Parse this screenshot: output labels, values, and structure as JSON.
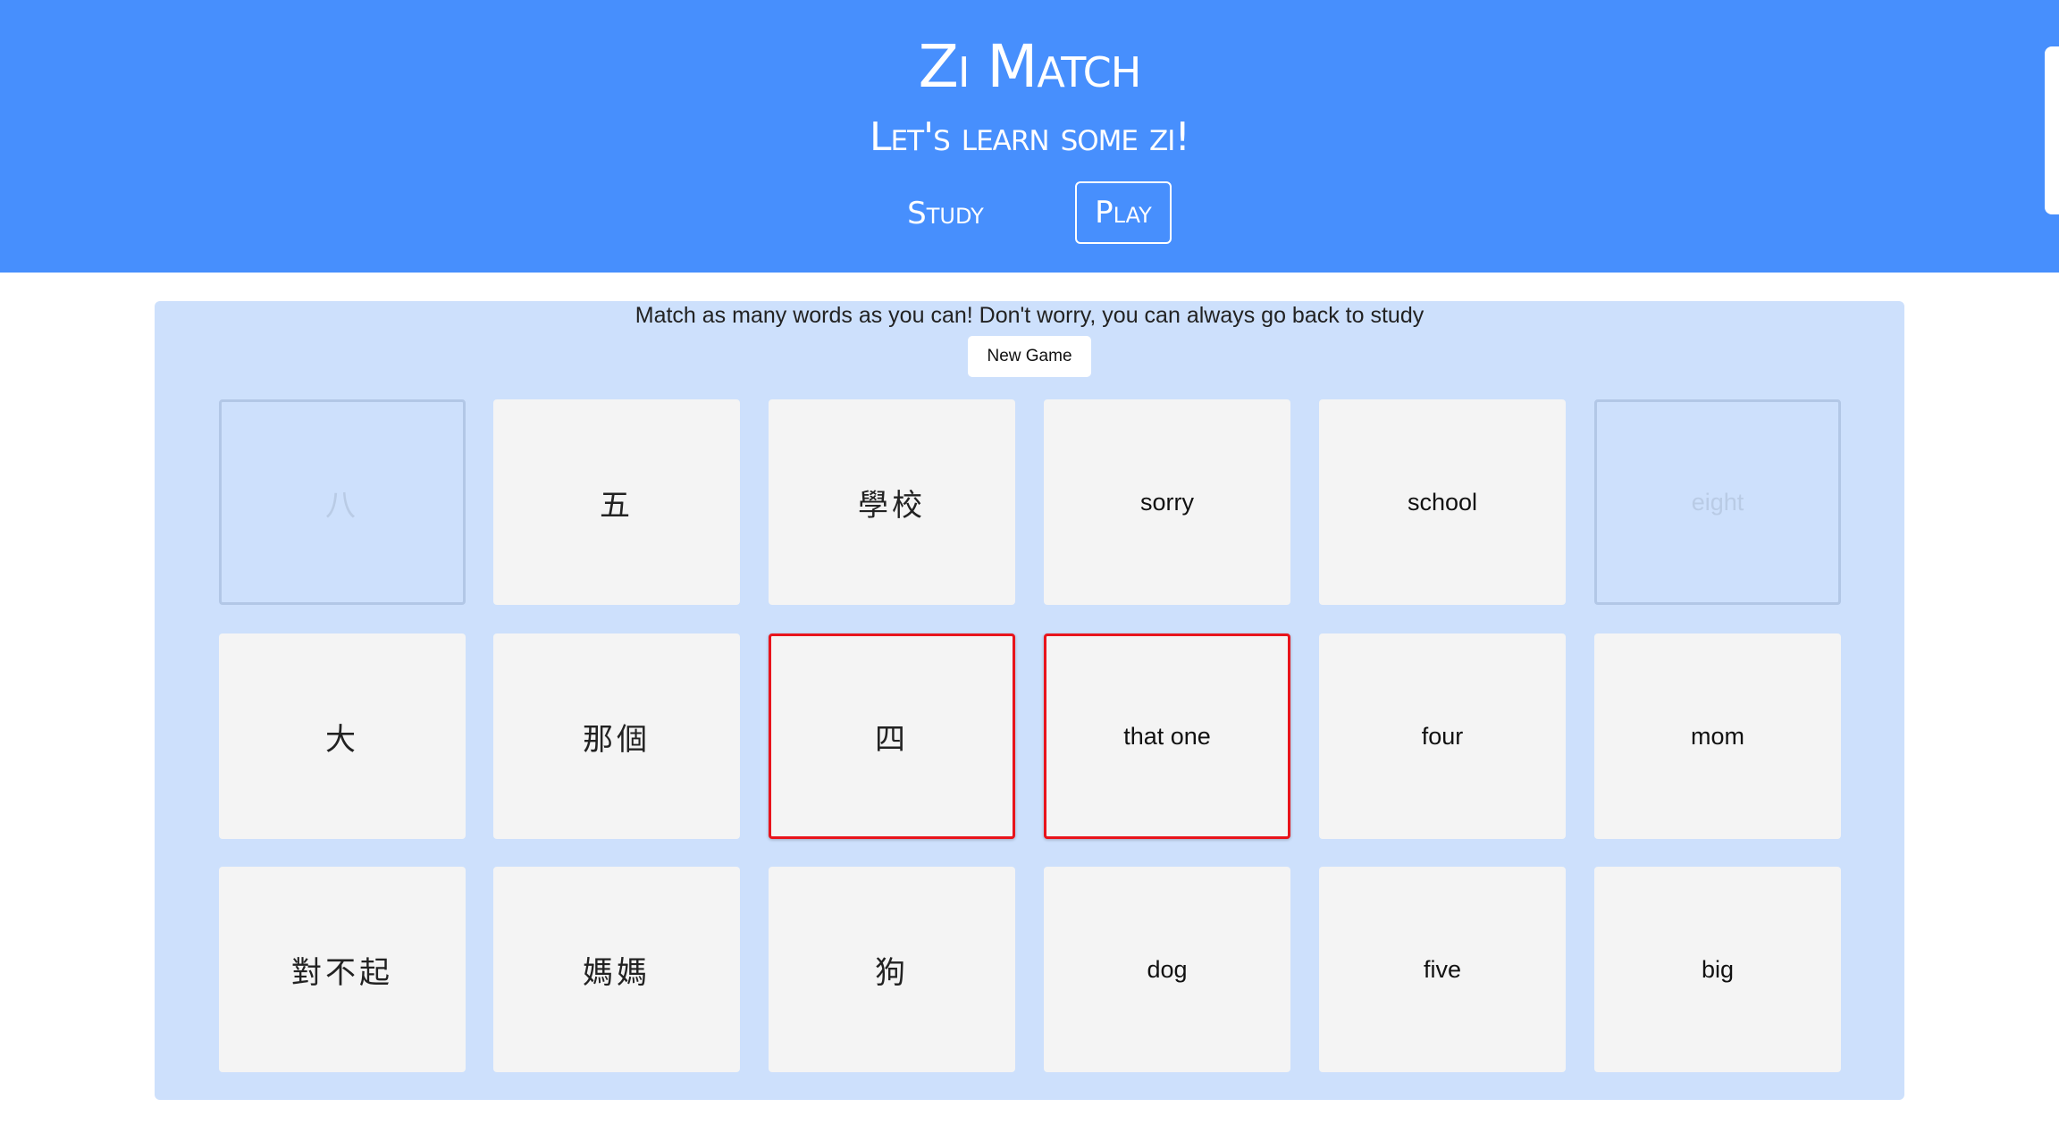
{
  "header": {
    "title": "Zi Match",
    "subtitle": "Let's learn some zi!",
    "nav": [
      {
        "label": "Study",
        "active": false
      },
      {
        "label": "Play",
        "active": true
      }
    ]
  },
  "game": {
    "instructions": "Match as many words as you can! Don't worry, you can always go back to study",
    "new_game_label": "New Game",
    "cards": [
      [
        {
          "text": "八",
          "lang": "zh",
          "state": "matched"
        },
        {
          "text": "五",
          "lang": "zh",
          "state": "normal"
        },
        {
          "text": "學校",
          "lang": "zh",
          "state": "normal"
        },
        {
          "text": "sorry",
          "lang": "en",
          "state": "normal"
        },
        {
          "text": "school",
          "lang": "en",
          "state": "normal"
        },
        {
          "text": "eight",
          "lang": "en",
          "state": "matched"
        }
      ],
      [
        {
          "text": "大",
          "lang": "zh",
          "state": "normal"
        },
        {
          "text": "那個",
          "lang": "zh",
          "state": "normal"
        },
        {
          "text": "四",
          "lang": "zh",
          "state": "selected"
        },
        {
          "text": "that one",
          "lang": "en",
          "state": "selected"
        },
        {
          "text": "four",
          "lang": "en",
          "state": "normal"
        },
        {
          "text": "mom",
          "lang": "en",
          "state": "normal"
        }
      ],
      [
        {
          "text": "對不起",
          "lang": "zh",
          "state": "normal"
        },
        {
          "text": "媽媽",
          "lang": "zh",
          "state": "normal"
        },
        {
          "text": "狗",
          "lang": "zh",
          "state": "normal"
        },
        {
          "text": "dog",
          "lang": "en",
          "state": "normal"
        },
        {
          "text": "five",
          "lang": "en",
          "state": "normal"
        },
        {
          "text": "big",
          "lang": "en",
          "state": "normal"
        }
      ]
    ]
  },
  "colors": {
    "header_bg": "#478ffd",
    "panel_bg": "#cde0fc",
    "card_bg": "#f4f4f4",
    "selected_border": "#e8141c"
  }
}
